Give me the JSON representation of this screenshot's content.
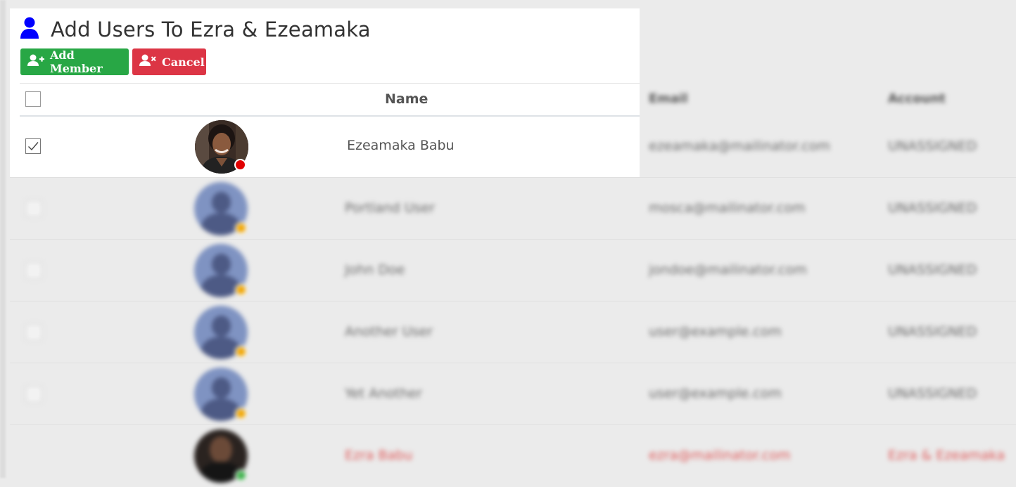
{
  "dialog": {
    "title": "Add Users To Ezra & Ezeamaka",
    "add_button": "Add Member",
    "cancel_button": "Cancel"
  },
  "table": {
    "headers": {
      "name": "Name",
      "email": "Email",
      "account": "Account"
    },
    "selected_row": {
      "name": "Ezeamaka Babu",
      "checked": true,
      "status": "red"
    },
    "rows": [
      {
        "name": "Ezeamaka Babu",
        "email": "ezeamaka@mailinator.com",
        "account": "UNASSIGNED"
      },
      {
        "name": "Portland User",
        "email": "mosca@mailinator.com",
        "account": "UNASSIGNED"
      },
      {
        "name": "John Doe",
        "email": "jondoe@mailinator.com",
        "account": "UNASSIGNED"
      },
      {
        "name": "Another User",
        "email": "user@example.com",
        "account": "UNASSIGNED"
      },
      {
        "name": "Yet Another",
        "email": "user@example.com",
        "account": "UNASSIGNED"
      },
      {
        "name": "Ezra Babu",
        "email": "ezra@mailinator.com",
        "account": "Ezra & Ezeamaka"
      }
    ]
  },
  "colors": {
    "add": "#28a745",
    "cancel": "#dc3545",
    "title_icon": "#0000ff"
  }
}
